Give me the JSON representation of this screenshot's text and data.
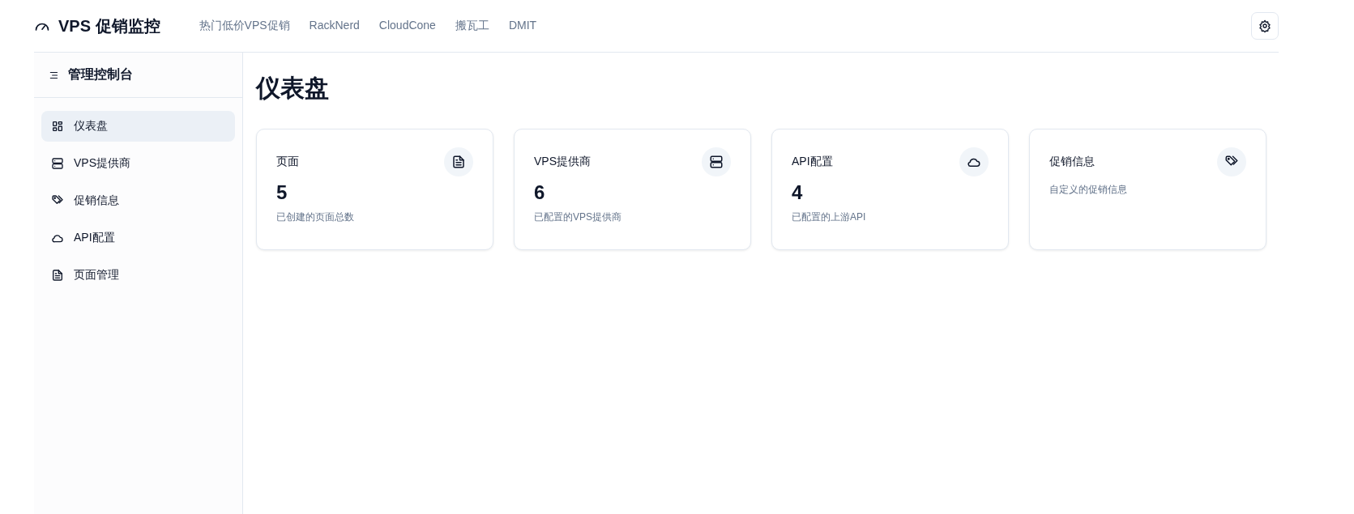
{
  "header": {
    "logo": "VPS 促销监控",
    "nav": [
      "热门低价VPS促销",
      "RackNerd",
      "CloudCone",
      "搬瓦工",
      "DMIT"
    ]
  },
  "sidebar": {
    "title": "管理控制台",
    "items": [
      {
        "label": "仪表盘",
        "selected": true
      },
      {
        "label": "VPS提供商",
        "selected": false
      },
      {
        "label": "促销信息",
        "selected": false
      },
      {
        "label": "API配置",
        "selected": false
      },
      {
        "label": "页面管理",
        "selected": false
      }
    ]
  },
  "main": {
    "title": "仪表盘",
    "cards": [
      {
        "title": "页面",
        "value": "5",
        "description": "已创建的页面总数"
      },
      {
        "title": "VPS提供商",
        "value": "6",
        "description": "已配置的VPS提供商"
      },
      {
        "title": "API配置",
        "value": "4",
        "description": "已配置的上游API"
      },
      {
        "title": "促销信息",
        "description": "自定义的促销信息"
      }
    ]
  }
}
